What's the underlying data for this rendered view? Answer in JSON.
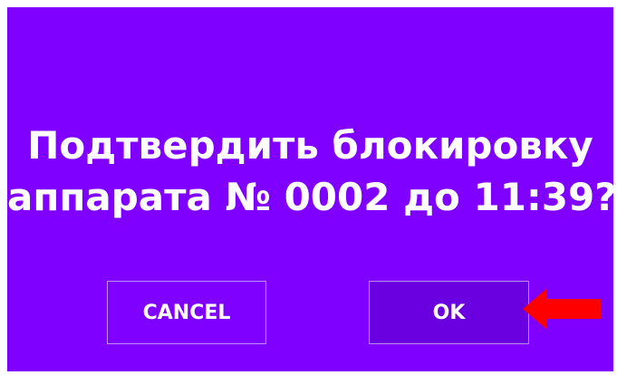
{
  "dialog": {
    "message_line1": "Подтвердить блокировку",
    "message_line2": "аппарата № 0002 до 11:39?",
    "cancel_label": "CANCEL",
    "ok_label": "OK"
  },
  "colors": {
    "background": "#7f00ff",
    "ok_button": "#6a00e0",
    "text": "#ffffff",
    "arrow": "#ff0000"
  },
  "annotation": {
    "icon": "left-arrow-icon"
  }
}
